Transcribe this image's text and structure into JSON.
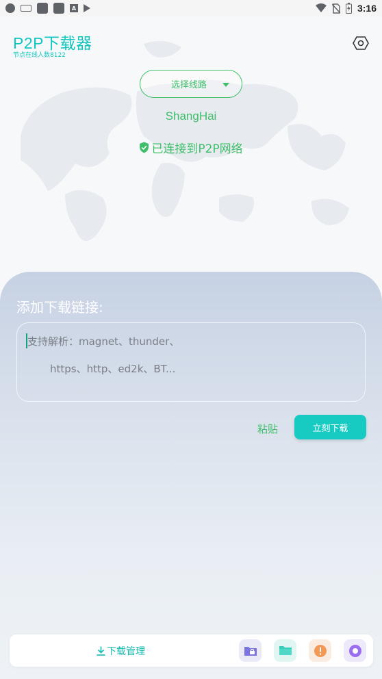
{
  "status_bar": {
    "time": "3:16",
    "icons": [
      "circle-icon",
      "keyboard-icon",
      "app-icon",
      "app-icon",
      "a-icon",
      "play-store-icon",
      "wifi-icon",
      "no-sim-icon",
      "battery-icon"
    ]
  },
  "header": {
    "title": "P2P下载器",
    "subtitle": "节点在线人数8122"
  },
  "network": {
    "route_select_label": "选择线路",
    "location": "ShangHai",
    "status": "已连接到P2P网络"
  },
  "add_link": {
    "title": "添加下载链接:",
    "placeholder_line1": "支持解析：magnet、thunder、",
    "placeholder_line2": "https、http、ed2k、BT...",
    "paste_label": "粘贴",
    "download_label": "立刻下载"
  },
  "bottom_nav": {
    "download_manager_label": "下载管理",
    "icons": [
      "folder-lock-icon",
      "folder-icon",
      "alert-icon",
      "record-icon"
    ]
  },
  "colors": {
    "accent_teal": "#14c6c0",
    "accent_green": "#3fbf6b",
    "button_teal": "#18cbc2"
  }
}
